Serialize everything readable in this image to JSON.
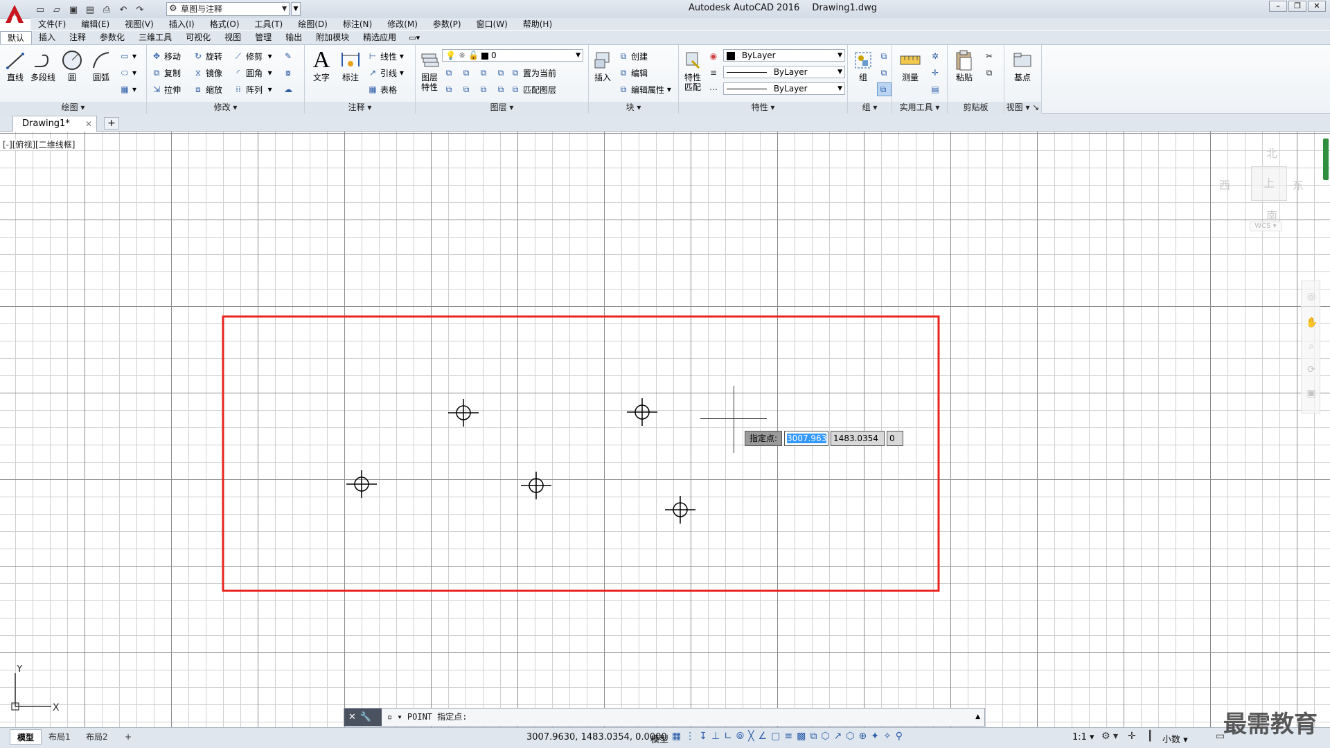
{
  "app": {
    "title": "Autodesk AutoCAD 2016",
    "filename": "Drawing1.dwg",
    "workspace": "草图与注释"
  },
  "menu": [
    "文件(F)",
    "编辑(E)",
    "视图(V)",
    "插入(I)",
    "格式(O)",
    "工具(T)",
    "绘图(D)",
    "标注(N)",
    "修改(M)",
    "参数(P)",
    "窗口(W)",
    "帮助(H)"
  ],
  "ribbon_tabs": [
    "默认",
    "插入",
    "注释",
    "参数化",
    "三维工具",
    "可视化",
    "视图",
    "管理",
    "输出",
    "附加模块",
    "精选应用"
  ],
  "ribbon": {
    "draw": {
      "title": "绘图",
      "line": "直线",
      "polyline": "多段线",
      "circle": "圆",
      "arc": "圆弧"
    },
    "modify": {
      "title": "修改",
      "move": "移动",
      "rotate": "旋转",
      "trim": "修剪",
      "copy": "复制",
      "mirror": "镜像",
      "fillet": "圆角",
      "stretch": "拉伸",
      "scale": "缩放",
      "array": "阵列"
    },
    "annotation": {
      "title": "注释",
      "text": "文字",
      "dimension": "标注",
      "linear": "线性",
      "leader": "引线",
      "table": "表格"
    },
    "layers": {
      "title": "图层",
      "properties": "图层\n特性",
      "current_layer": "0",
      "make_current": "置为当前",
      "match_layer": "匹配图层"
    },
    "block": {
      "title": "块",
      "insert": "插入",
      "create": "创建",
      "edit": "编辑",
      "edit_attributes": "编辑属性"
    },
    "properties": {
      "title": "特性",
      "match": "特性\n匹配",
      "color": "ByLayer",
      "linetype": "ByLayer",
      "lineweight": "ByLayer"
    },
    "groups": {
      "title": "组",
      "group": "组"
    },
    "utilities": {
      "title": "实用工具",
      "measure": "测量"
    },
    "clipboard": {
      "title": "剪贴板",
      "paste": "粘贴"
    },
    "view": {
      "title": "视图",
      "base": "基点"
    }
  },
  "file_tab": {
    "name": "Drawing1*"
  },
  "viewport_label": "[-][俯视][二维线框]",
  "viewcube": {
    "north": "北",
    "south": "南",
    "east": "东",
    "west": "西",
    "face": "上",
    "wcs": "WCS"
  },
  "dynamic_input": {
    "prompt": "指定点:",
    "x": "3007.963",
    "y": "1483.0354",
    "z": "0"
  },
  "ucs": {
    "x": "X",
    "y": "Y"
  },
  "command_line": {
    "text": "▫ ▾ POINT 指定点:"
  },
  "layout_tabs": [
    "模型",
    "布局1",
    "布局2"
  ],
  "status": {
    "coords": "3007.9630, 1483.0354, 0.0000",
    "model": "模型",
    "scale": "1:1",
    "units": "小数"
  },
  "watermark": "最需教育",
  "colors": {
    "boundary": "#e8231f",
    "accent": "#3399ff",
    "logo": "#c8141c"
  }
}
